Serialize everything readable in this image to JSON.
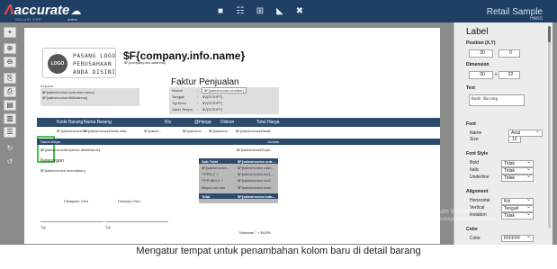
{
  "app": {
    "brand_mark": "Λ",
    "brand_word": "accurate",
    "brand_cloud": "☁",
    "brand_tagline": "SOLUSI ERP",
    "brand_online": "online",
    "title": "Retail Sample",
    "subtitle": "HANS"
  },
  "top_toolbar": [
    "■",
    "☷",
    "⊞",
    "◣",
    "✖"
  ],
  "left_toolbar": [
    "+",
    "⊕",
    "⊖",
    "⎘",
    "⎙",
    "▤",
    "▥",
    "☰",
    "↻",
    "↺"
  ],
  "canvas": {
    "logo_text": "LOGO",
    "logo_lines": [
      "PASANG LOGO",
      "PERUSAHAAN",
      "ANDA DISINI"
    ],
    "company_name": "$F{company.info.name}",
    "company_address": "$F{company.info.address}",
    "kepada_label": "Kepada",
    "customer_name": "$F{salesInvoice.customer.name}",
    "customer_address": "$F{salesInvoice.billAddress}",
    "faktur_title": "Faktur Penjualan",
    "info_rows": [
      {
        "label": "Nomor",
        "sep": ":",
        "value": "$F{salesInvoice.number}"
      },
      {
        "label": "Tanggal",
        "sep": ":",
        "value": "$V{SCRIPT}"
      },
      {
        "label": "Tgl Kirim",
        "sep": ":",
        "value": "$V{SCRIPT}"
      },
      {
        "label": "Jatuh Tempo",
        "sep": ":",
        "value": "$V{SCRIPT}"
      }
    ],
    "detail_headers": [
      "Kode Barang",
      "Nama Barang",
      "Kts",
      "@Harga",
      "Diskon",
      "Total Harga"
    ],
    "detail_values": [
      "$F{salesInvoiceDe...",
      "$F{salesInvoiceDetail.deta...",
      "$F{salesI...",
      "$F{salesInv...",
      "$F{salesInv...",
      "$F{salesInvoiceDetail."
    ],
    "biaya_headers": [
      "Nama Biaya",
      "Jumlah"
    ],
    "biaya_values": [
      "$F{salesInvoiceExpense.detailName}",
      "$F{salesInvoiceExpe..."
    ],
    "keterangan_label": "Keterangan",
    "description": "$F{salesInvoice.description}",
    "summary_rows": [
      {
        "label": "Sub Total",
        "value": "$F{salesInvoice.sub..."
      },
      {
        "label": "$F{salesInvoice...",
        "value": "$F{salesInvoice.cash..."
      },
      {
        "label": "**PPN (* +",
        "value": "$F{salesInvoice.tax1..."
      },
      {
        "label": "**PPnBM (* +",
        "value": "$F{salesInvoice.tax2..."
      },
      {
        "label": "Biaya Lain-lain",
        "value": "$F{salesInvoice.total..."
      },
      {
        "label": "Total",
        "value": "$F{salesInvoice.tota..."
      }
    ],
    "signature_labels": [
      "Disiapkan Oleh",
      "Disetujui Oleh"
    ],
    "tgl_labels": [
      "Tgl",
      "Tgl"
    ],
    "page_footer": "\"Halaman \" + $V{PA"
  },
  "panel": {
    "title": "Label",
    "position_label": "Position (X,Y)",
    "position_x": "30",
    "position_y": "0",
    "dimension_label": "Dimension",
    "width": "90",
    "dim_sep": "x",
    "height": "22",
    "text_label": "Text",
    "text_value": "Kode Barang",
    "font_label": "Font",
    "font_name_label": "Name",
    "font_name": "Arial",
    "font_size_label": "Size",
    "font_size": "10",
    "font_style_label": "Font Style",
    "bold_label": "Bold",
    "bold": "Tidak",
    "italic_label": "Italic",
    "italic": "Tidak",
    "underline_label": "Underline",
    "underline": "Tidak",
    "alignment_label": "Alignment",
    "horizontal_label": "Horizontal",
    "horizontal": "Kiri",
    "vertical_label": "Vertical",
    "vertical": "Tengah",
    "rotation_label": "Rotation",
    "rotation": "Tidak",
    "color_label": "Color",
    "color_sub_label": "Color",
    "color_value": "FFFFFF"
  },
  "watermark": {
    "line1": "Activate Windows",
    "line2": "Go to Settings to activate Windows."
  },
  "caption": "Mengatur tempat untuk penambahan kolom baru di detail barang",
  "colors": {
    "topbar": "#1f3f64",
    "header_band": "#2c4a6b",
    "selection": "#46c246",
    "workspace": "#8b8b8b"
  }
}
